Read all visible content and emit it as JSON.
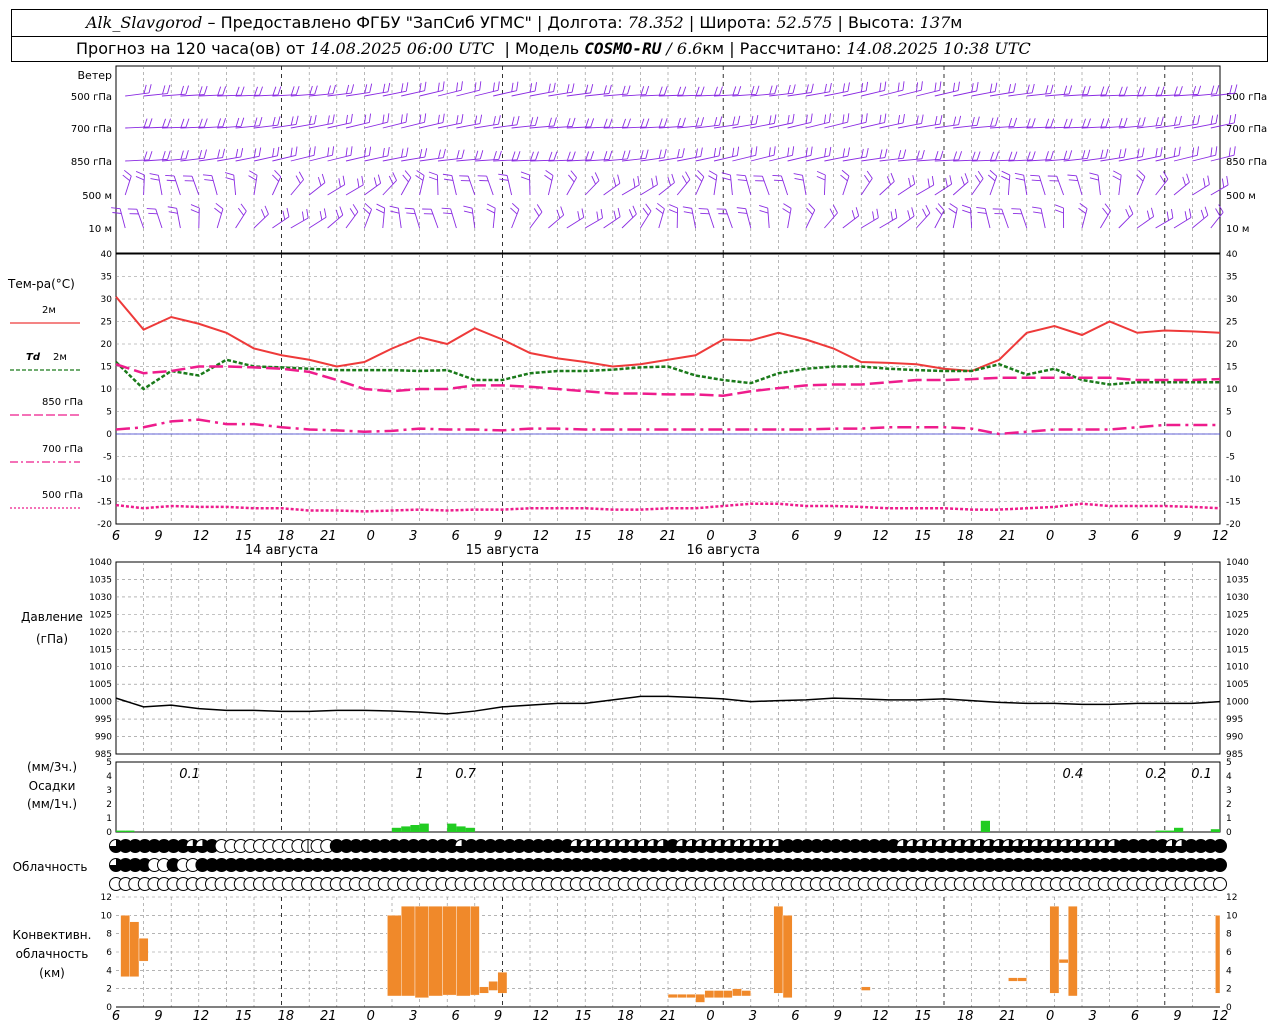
{
  "header": {
    "station": "Alk_Slavgorod",
    "dash": "–",
    "provider": "Предоставлено ФГБУ \"ЗапСиб УГМС\"",
    "sep": "|",
    "lon_label": "Долгота:",
    "lon_value": "78.352",
    "lat_label": "Широта:",
    "lat_value": "52.575",
    "alt_label": "Высота:",
    "alt_value": "137",
    "alt_unit": "м",
    "forecast_prefix": "Прогноз на 120 часа(ов) от",
    "forecast_time": "14.08.2025 06:00 UTC",
    "model_label": "Модель",
    "model_name": "COSMO-RU",
    "model_slash": "/",
    "model_res": "6.6",
    "model_res_unit": "км",
    "calc_label": "Рассчитано:",
    "calc_time": "14.08.2025 10:38 UTC"
  },
  "time_axis": {
    "hours": [
      "6",
      "9",
      "12",
      "15",
      "18",
      "21",
      "0",
      "3",
      "6",
      "9",
      "12",
      "15",
      "18",
      "21",
      "0",
      "3",
      "6",
      "9",
      "12",
      "15",
      "18",
      "21",
      "0",
      "3",
      "6",
      "9",
      "12"
    ],
    "dates": [
      "14 августа",
      "15 августа",
      "16 августа"
    ]
  },
  "wind_panel": {
    "title": "Ветер",
    "levels": [
      "500 гПа",
      "700 гПа",
      "850 гПа",
      "500 м",
      "10 м"
    ],
    "color": "#8a2be2"
  },
  "temp_panel": {
    "title": "Тем-ра(°C)",
    "legend": [
      {
        "label": "2м",
        "italic_prefix": "",
        "color": "#ee3a3a",
        "style": "solid"
      },
      {
        "label": "2м",
        "italic_prefix": "Td",
        "color": "#1a7a1a",
        "style": "dash"
      },
      {
        "label": "850 гПа",
        "italic_prefix": "",
        "color": "#ee1c8c",
        "style": "longdash"
      },
      {
        "label": "700 гПа",
        "italic_prefix": "",
        "color": "#ee1c8c",
        "style": "dashdot"
      },
      {
        "label": "500 гПа",
        "italic_prefix": "",
        "color": "#ee1c8c",
        "style": "dot"
      }
    ],
    "y_ticks": [
      "40",
      "35",
      "30",
      "25",
      "20",
      "15",
      "10",
      "5",
      "0",
      "-5",
      "-10",
      "-15",
      "-20"
    ]
  },
  "pressure_panel": {
    "title_line1": "Давление",
    "title_line2": "(гПа)",
    "y_ticks": [
      "1040",
      "1035",
      "1030",
      "1025",
      "1020",
      "1015",
      "1010",
      "1005",
      "1000",
      "995",
      "990",
      "985"
    ]
  },
  "precip_panel": {
    "unit_3h": "(мм/3ч.)",
    "title": "Осадки",
    "unit_1h": "(мм/1ч.)",
    "y_ticks": [
      "5",
      "4",
      "3",
      "2",
      "1",
      "0"
    ],
    "labels": [
      {
        "text": "0.1",
        "h": 8
      },
      {
        "text": "1",
        "h": 33
      },
      {
        "text": "0.7",
        "h": 38
      },
      {
        "text": "0.4",
        "h": 104
      },
      {
        "text": "0.2",
        "h": 113
      },
      {
        "text": "0.1",
        "h": 118
      }
    ]
  },
  "cloud_panel": {
    "title": "Облачность",
    "rows": [
      "89999999889000000000100999999999999989999999999988888888889888888888889999999999998888888888888888888888899999889999",
      "89990090099999999999999999999999999999999999999999999999999999999999999999999999999999999999999999999999999999999999",
      "00000000000000000000000000000000000000000000000000000000000000000000000000000000000000000000000000000000000000000000"
    ]
  },
  "conv_panel": {
    "title_line1": "Конвективн.",
    "title_line2": "облачность",
    "title_line3": "(км)",
    "y_ticks": [
      "12",
      "10",
      "8",
      "6",
      "4",
      "2",
      "0"
    ],
    "color": "#f0892a"
  },
  "chart_data": [
    {
      "type": "line",
      "title": "Тем-ра(°C)",
      "ylabel": "Тем-ра(°C)",
      "x_hours_from_start": [
        0,
        3,
        6,
        9,
        12,
        15,
        18,
        21,
        24,
        27,
        30,
        33,
        36,
        39,
        42,
        45,
        48,
        51,
        54,
        57,
        60,
        63,
        66,
        69,
        72,
        75,
        78,
        81,
        84,
        87,
        90,
        93,
        96,
        99,
        102,
        105,
        108,
        111,
        114,
        117,
        120
      ],
      "ylim": [
        -20,
        40
      ],
      "series": [
        {
          "name": "2м",
          "values": [
            30.5,
            23.2,
            26,
            24.5,
            22.5,
            19,
            17.5,
            16.5,
            15,
            16,
            19,
            21.5,
            20,
            23.5,
            21,
            18,
            16.8,
            16,
            15,
            15.5,
            16.5,
            17.5,
            21,
            20.8,
            22.5,
            21,
            19,
            16,
            15.8,
            15.5,
            14.5,
            14,
            16.5,
            22.5,
            24,
            22,
            25,
            22.5,
            23,
            22.8,
            22.5
          ]
        },
        {
          "name": "Td 2м",
          "values": [
            16,
            10,
            14,
            13,
            16.5,
            15,
            14.8,
            14.5,
            14.2,
            14.2,
            14.2,
            14,
            14.2,
            12,
            12,
            13.5,
            14,
            14,
            14.3,
            14.8,
            15,
            13,
            12,
            11.3,
            13.5,
            14.5,
            15,
            15,
            14.5,
            14.2,
            14,
            14,
            15.5,
            13.2,
            14.5,
            12,
            11,
            11.5,
            11.5,
            11.5,
            11.5
          ]
        },
        {
          "name": "850 гПа",
          "values": [
            15.5,
            13.5,
            14,
            15,
            15,
            14.8,
            14.5,
            13.8,
            12,
            10,
            9.5,
            10,
            10,
            10.8,
            10.8,
            10.5,
            10,
            9.5,
            9,
            9,
            8.8,
            8.8,
            8.5,
            9.5,
            10.2,
            10.8,
            11,
            11,
            11.5,
            12,
            12,
            12.2,
            12.5,
            12.5,
            12.5,
            12.5,
            12.5,
            12,
            12,
            12,
            12.2
          ]
        },
        {
          "name": "700 гПа",
          "values": [
            1,
            1.5,
            2.8,
            3.2,
            2.2,
            2.2,
            1.5,
            1,
            0.8,
            0.5,
            0.7,
            1.2,
            1,
            1,
            0.8,
            1.2,
            1.2,
            1,
            1,
            1,
            1,
            1,
            1,
            1,
            1,
            1,
            1.2,
            1.2,
            1.5,
            1.5,
            1.5,
            1.2,
            0,
            0.5,
            1,
            1,
            1,
            1.5,
            2,
            2,
            2
          ]
        },
        {
          "name": "500 гПа",
          "values": [
            -15.8,
            -16.5,
            -16,
            -16.2,
            -16.2,
            -16.5,
            -16.5,
            -17,
            -17,
            -17.2,
            -17,
            -16.8,
            -17,
            -16.8,
            -16.8,
            -16.5,
            -16.5,
            -16.5,
            -16.8,
            -16.8,
            -16.5,
            -16.5,
            -16,
            -15.5,
            -15.5,
            -16,
            -16,
            -16.2,
            -16.5,
            -16.5,
            -16.5,
            -16.8,
            -16.8,
            -16.5,
            -16.2,
            -15.5,
            -16,
            -16,
            -16,
            -16.2,
            -16.5
          ]
        }
      ]
    },
    {
      "type": "line",
      "title": "Давление",
      "ylabel": "(гПа)",
      "ylim": [
        985,
        1040
      ],
      "x_hours_from_start": [
        0,
        3,
        6,
        9,
        12,
        15,
        18,
        21,
        24,
        27,
        30,
        33,
        36,
        39,
        42,
        45,
        48,
        51,
        54,
        57,
        60,
        63,
        66,
        69,
        72,
        75,
        78,
        81,
        84,
        87,
        90,
        93,
        96,
        99,
        102,
        105,
        108,
        111,
        114,
        117,
        120
      ],
      "series": [
        {
          "name": "",
          "values": [
            1001,
            998.5,
            999,
            998,
            997.5,
            997.5,
            997.2,
            997.2,
            997.5,
            997.5,
            997.3,
            997,
            996.5,
            997.3,
            998.5,
            999,
            999.5,
            999.5,
            1000.5,
            1001.5,
            1001.5,
            1001.2,
            1000.8,
            1000,
            1000.3,
            1000.5,
            1001,
            1000.8,
            1000.5,
            1000.5,
            1000.8,
            1000.3,
            999.8,
            999.5,
            999.5,
            999.2,
            999.2,
            999.5,
            999.5,
            999.5,
            1000
          ]
        }
      ]
    },
    {
      "type": "bar",
      "title": "Осадки",
      "ylabel": "(мм/1ч.)",
      "ylim": [
        0,
        5
      ],
      "x_hours_from_start": [
        1,
        2,
        31,
        32,
        33,
        34,
        35,
        37,
        38,
        39,
        40,
        95,
        114,
        115,
        116,
        117,
        118,
        120
      ],
      "values": [
        0.1,
        0.1,
        0.3,
        0.4,
        0.5,
        0.6,
        0,
        0.6,
        0.4,
        0.3,
        0,
        0.8,
        0.1,
        0.1,
        0.3,
        0,
        0,
        0.2
      ],
      "colors": {
        "bar": "#22cc22"
      }
    },
    {
      "type": "bar",
      "title": "Конвективн. облачность",
      "ylabel": "(км)",
      "ylim": [
        0,
        12
      ],
      "bars": [
        {
          "h0": 0.5,
          "h1": 1.5,
          "base": 3.3,
          "top": 10
        },
        {
          "h0": 1.5,
          "h1": 2.5,
          "base": 3.3,
          "top": 9.3
        },
        {
          "h0": 2.5,
          "h1": 3.5,
          "base": 5,
          "top": 7.5
        },
        {
          "h0": 29.5,
          "h1": 31,
          "base": 1.2,
          "top": 10
        },
        {
          "h0": 31,
          "h1": 32.5,
          "base": 1.2,
          "top": 11
        },
        {
          "h0": 32.5,
          "h1": 34,
          "base": 1.0,
          "top": 11
        },
        {
          "h0": 34,
          "h1": 35.5,
          "base": 1.2,
          "top": 11
        },
        {
          "h0": 35.5,
          "h1": 37,
          "base": 1.3,
          "top": 11
        },
        {
          "h0": 37,
          "h1": 38.5,
          "base": 1.2,
          "top": 11
        },
        {
          "h0": 38.5,
          "h1": 39.5,
          "base": 1.3,
          "top": 11
        },
        {
          "h0": 39.5,
          "h1": 40.5,
          "base": 1.5,
          "top": 2.2
        },
        {
          "h0": 40.5,
          "h1": 41.5,
          "base": 1.8,
          "top": 2.8
        },
        {
          "h0": 41.5,
          "h1": 42.5,
          "base": 1.5,
          "top": 3.8
        },
        {
          "h0": 60,
          "h1": 61,
          "base": 1.0,
          "top": 1.4
        },
        {
          "h0": 61,
          "h1": 62,
          "base": 1.0,
          "top": 1.4
        },
        {
          "h0": 62,
          "h1": 63,
          "base": 1.0,
          "top": 1.4
        },
        {
          "h0": 63,
          "h1": 64,
          "base": 0.5,
          "top": 1.4
        },
        {
          "h0": 64,
          "h1": 65,
          "base": 1.0,
          "top": 1.8
        },
        {
          "h0": 65,
          "h1": 66,
          "base": 1.0,
          "top": 1.8
        },
        {
          "h0": 66,
          "h1": 67,
          "base": 1.0,
          "top": 1.8
        },
        {
          "h0": 67,
          "h1": 68,
          "base": 1.2,
          "top": 2.0
        },
        {
          "h0": 68,
          "h1": 69,
          "base": 1.2,
          "top": 1.8
        },
        {
          "h0": 71.5,
          "h1": 72.5,
          "base": 1.5,
          "top": 11
        },
        {
          "h0": 72.5,
          "h1": 73.5,
          "base": 1.0,
          "top": 10
        },
        {
          "h0": 81,
          "h1": 82,
          "base": 1.8,
          "top": 2.2
        },
        {
          "h0": 97,
          "h1": 98,
          "base": 2.8,
          "top": 3.2
        },
        {
          "h0": 98,
          "h1": 99,
          "base": 2.8,
          "top": 3.2
        },
        {
          "h0": 101.5,
          "h1": 102.5,
          "base": 1.5,
          "top": 11
        },
        {
          "h0": 102.5,
          "h1": 103.5,
          "base": 4.8,
          "top": 5.2
        },
        {
          "h0": 103.5,
          "h1": 104.5,
          "base": 1.2,
          "top": 11
        },
        {
          "h0": 119.5,
          "h1": 120,
          "base": 1.5,
          "top": 10
        }
      ]
    }
  ]
}
